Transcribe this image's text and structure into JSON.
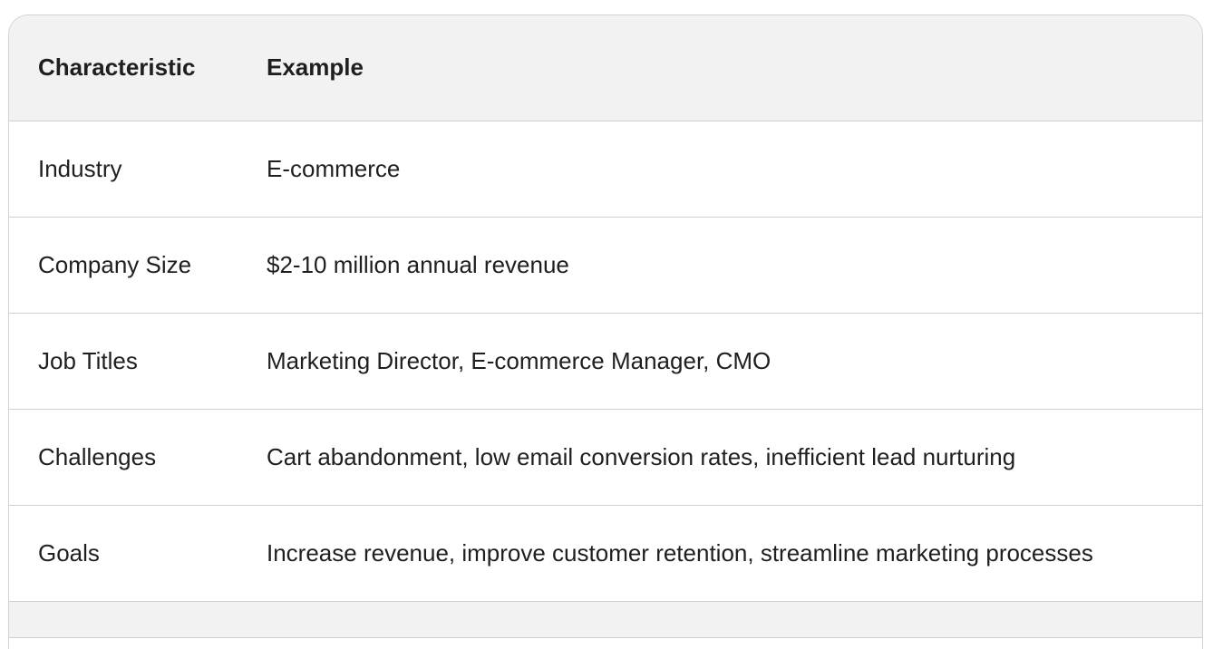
{
  "table": {
    "headers": [
      "Characteristic",
      "Example"
    ],
    "rows": [
      {
        "characteristic": "Industry",
        "example": "E-commerce"
      },
      {
        "characteristic": "Company Size",
        "example": "$2-10 million annual revenue"
      },
      {
        "characteristic": "Job Titles",
        "example": "Marketing Director, E-commerce Manager, CMO"
      },
      {
        "characteristic": "Challenges",
        "example": "Cart abandonment, low email conversion rates, inefficient lead nurturing"
      },
      {
        "characteristic": "Goals",
        "example": "Increase revenue, improve customer retention, streamline marketing processes"
      }
    ]
  },
  "colors": {
    "header_bg": "#f2f2f2",
    "border": "#cfcfcf",
    "text": "#1f1f1f"
  }
}
